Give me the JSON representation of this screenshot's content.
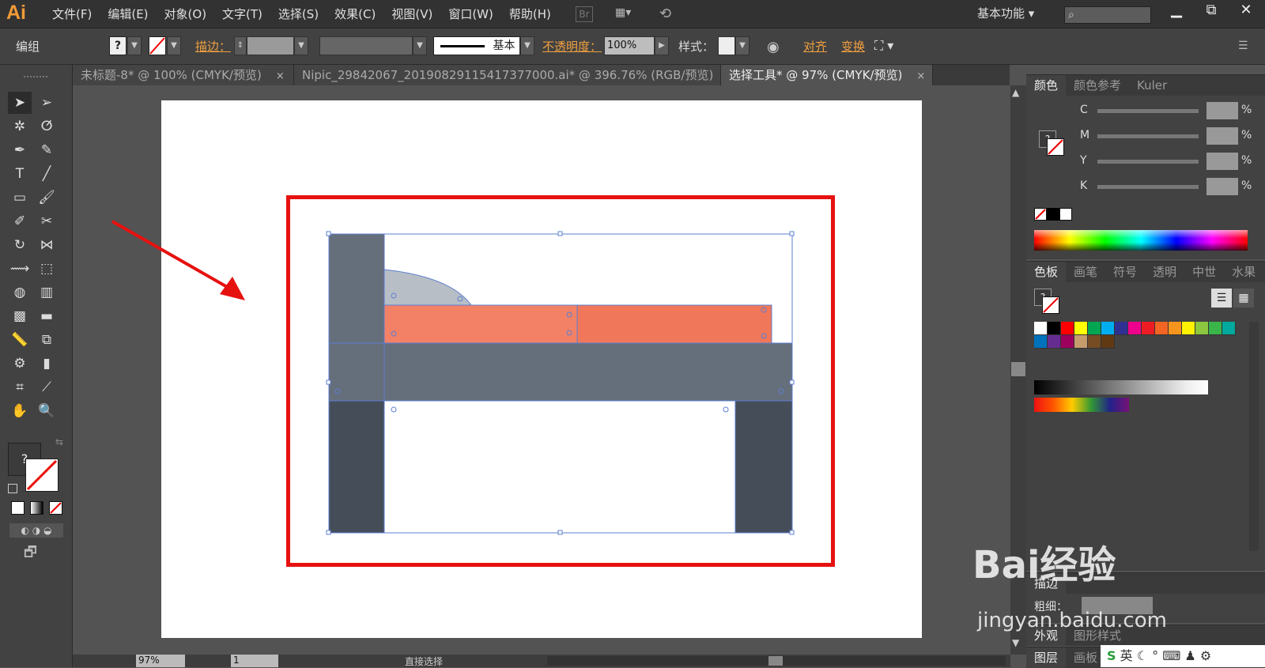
{
  "app": {
    "logo": "Ai",
    "br": "Br"
  },
  "menu": [
    "文件(F)",
    "编辑(E)",
    "对象(O)",
    "文字(T)",
    "选择(S)",
    "效果(C)",
    "视图(V)",
    "窗口(W)",
    "帮助(H)"
  ],
  "workspace": "基本功能",
  "window": {
    "minimize": "▁",
    "restore": "⧉",
    "close": "✕"
  },
  "control": {
    "group": "编组",
    "stroke_label": "描边：",
    "line_style": "基本",
    "opacity_label": "不透明度：",
    "opacity": "100%",
    "style_label": "样式：",
    "align": "对齐",
    "transform": "变换"
  },
  "tabs": [
    {
      "label": "未标题-8* @ 100% (CMYK/预览)",
      "close": "×"
    },
    {
      "label": "Nipic_29842067_20190829115417377000.ai* @ 396.76% (RGB/预览)",
      "close": "×"
    },
    {
      "label": "选择工具* @ 97% (CMYK/预览)",
      "close": "×"
    }
  ],
  "color_panel": {
    "tabs": [
      "颜色",
      "颜色参考",
      "Kuler"
    ],
    "channels": [
      "C",
      "M",
      "Y",
      "K"
    ],
    "unit": "%"
  },
  "swatch_panel": {
    "tabs": [
      "色板",
      "画笔",
      "符号",
      "透明",
      "中世",
      "水果"
    ],
    "colors": [
      "#ffffff",
      "#000000",
      "#ff0000",
      "#ffff00",
      "#00a651",
      "#00aeef",
      "#2e3192",
      "#ec008c",
      "#ed1c24",
      "#f26522",
      "#f7941d",
      "#fff200",
      "#8dc63f",
      "#39b54a",
      "#00a99d",
      "#0072bc",
      "#662d91",
      "#9e005d",
      "#c69c6d",
      "#754c24",
      "#603913"
    ]
  },
  "stroke_panel": {
    "title": "描边",
    "weight_label": "粗细："
  },
  "appearance_tabs": [
    "外观",
    "图形样式"
  ],
  "layers_tabs": [
    "图层",
    "画板"
  ],
  "status": {
    "zoom": "97%",
    "page": "1",
    "tool": "直接选择"
  },
  "watermark": {
    "line1": "Bai经验",
    "line2": "jingyan.baidu.com"
  },
  "ime": {
    "label": "英"
  }
}
